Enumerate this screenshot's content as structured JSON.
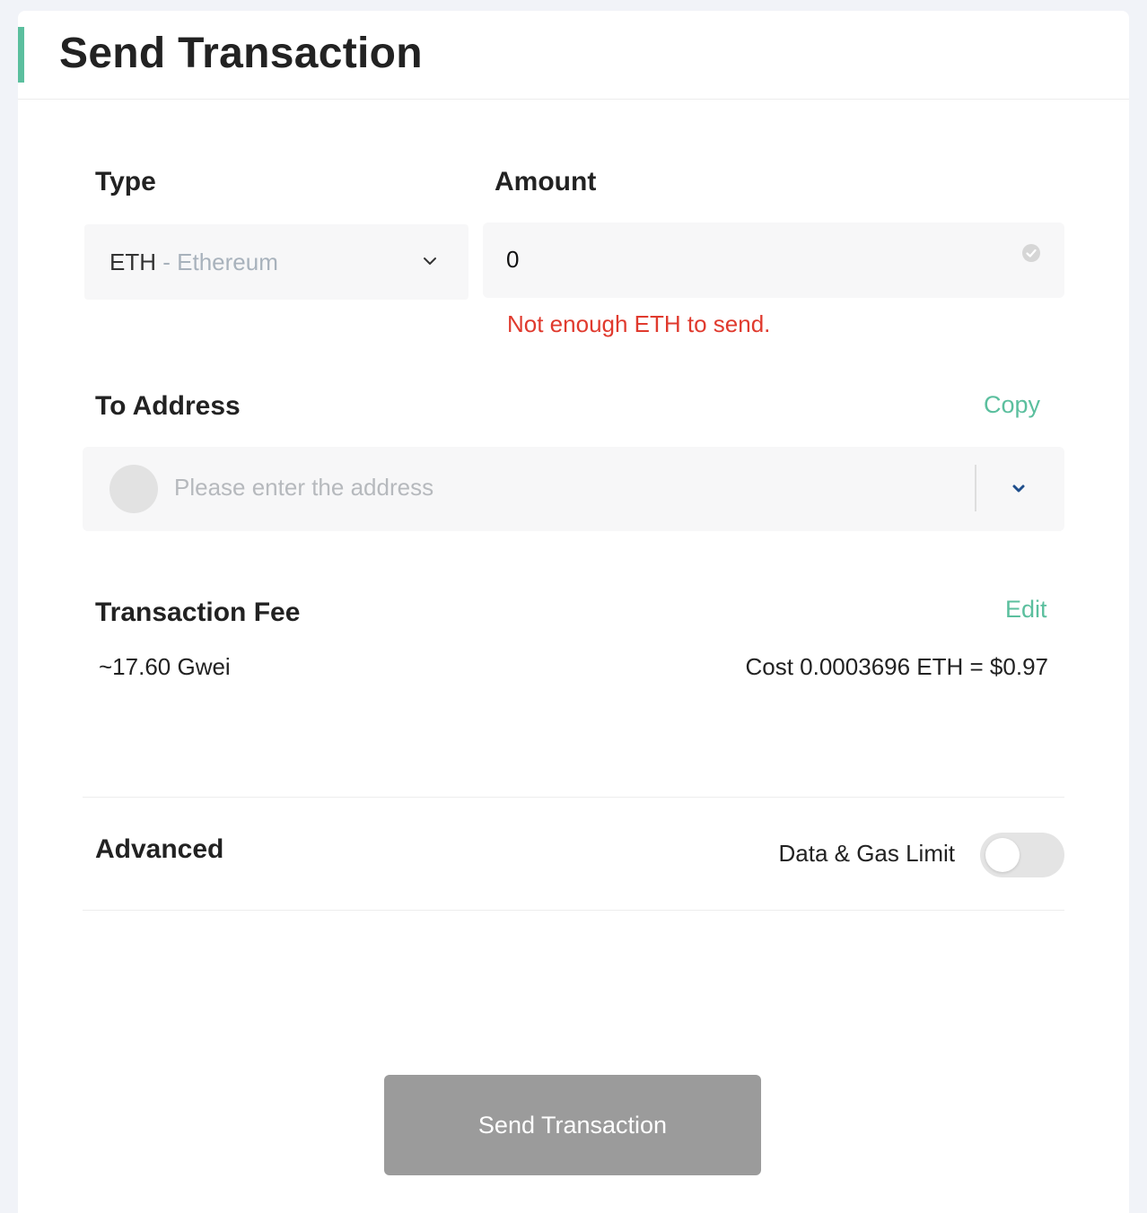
{
  "header": {
    "title": "Send Transaction",
    "accent_color": "#5bbf9e"
  },
  "type_field": {
    "label": "Type",
    "selected_code": "ETH",
    "selected_separator": "-",
    "selected_name": "Ethereum",
    "icon": "chevron-down-icon"
  },
  "amount_field": {
    "label": "Amount",
    "value": "0",
    "error": "Not enough ETH to send.",
    "error_color": "#e03a2e",
    "icon": "check-circle-icon"
  },
  "address_field": {
    "label": "To Address",
    "copy_label": "Copy",
    "placeholder": "Please enter the address",
    "icon": "chevron-down-icon"
  },
  "fee": {
    "label": "Transaction Fee",
    "edit_label": "Edit",
    "gwei": "~17.60 Gwei",
    "cost": "Cost 0.0003696 ETH = $0.97"
  },
  "advanced": {
    "label": "Advanced",
    "toggle_label": "Data & Gas Limit",
    "toggle_on": false
  },
  "submit": {
    "label": "Send Transaction",
    "disabled": true
  }
}
